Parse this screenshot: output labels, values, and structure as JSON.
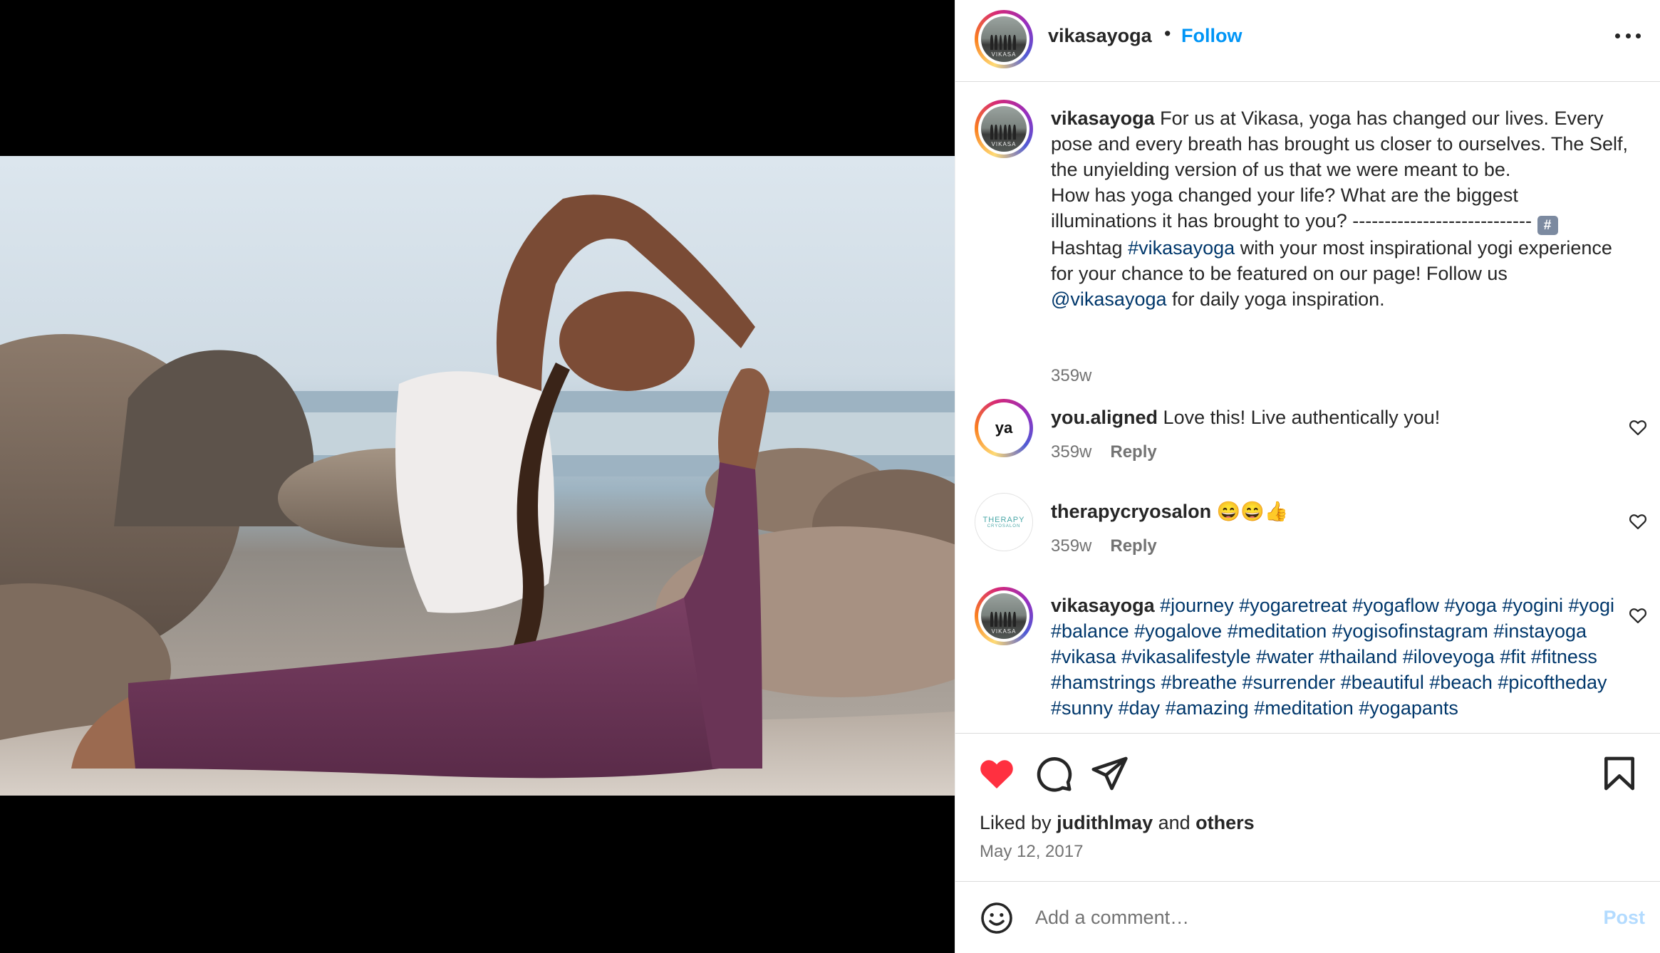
{
  "post": {
    "username": "vikasayoga",
    "separator": "•",
    "follow_label": "Follow",
    "avatar_text": "VIKASA"
  },
  "caption": {
    "username": "vikasayoga",
    "text_1": "For us at Vikasa, yoga has changed our lives. Every pose and every breath has brought us closer to ourselves. The Self, the unyielding version of us that we were meant to be.\nHow has yoga changed your life? What are the biggest illuminations it has brought to you? ---------------------------- ",
    "hash_glyph": "#",
    "text_2": " Hashtag ",
    "tag_1": "#vikasayoga",
    "text_3": " with your most inspirational yogi experience for your chance to be featured on our page! Follow us ",
    "mention": "@vikasayoga",
    "text_4": " for daily yoga inspiration.",
    "age": "359w"
  },
  "comments": [
    {
      "username": "you.aligned",
      "avatar_text": "ya",
      "text": "Love this! Live authentically you!",
      "age": "359w",
      "reply_label": "Reply"
    },
    {
      "username": "therapycryosalon",
      "avatar_text": "THERAPY",
      "avatar_subtext": "CRYOSALON",
      "text": "😄😄👍",
      "age": "359w",
      "reply_label": "Reply"
    },
    {
      "username": "vikasayoga",
      "text": "#journey #yogaretreat #yogaflow #yoga #yogini #yogi #balance #yogalove #meditation #yogisofinstagram #instayoga #vikasa #vikasalifestyle #water #thailand #iloveyoga #fit #fitness #hamstrings #breathe #surrender #beautiful #beach #picoftheday #sunny #day #amazing #meditation #yogapants"
    }
  ],
  "footer": {
    "liked_by_prefix": "Liked by ",
    "liked_by_user": "judithlmay",
    "liked_by_mid": " and ",
    "liked_by_others": "others",
    "date": "May 12, 2017",
    "comment_placeholder": "Add a comment…",
    "post_label": "Post"
  },
  "icons": {
    "like": "heart-icon",
    "comment": "comment-icon",
    "share": "share-icon",
    "save": "bookmark-icon",
    "emoji": "emoji-icon",
    "more": "more-options-icon"
  },
  "colors": {
    "accent": "#0095f6",
    "hashtag": "#00376b",
    "liked_heart": "#ff3040",
    "muted": "#737373",
    "post_disabled": "#b3dbff"
  }
}
